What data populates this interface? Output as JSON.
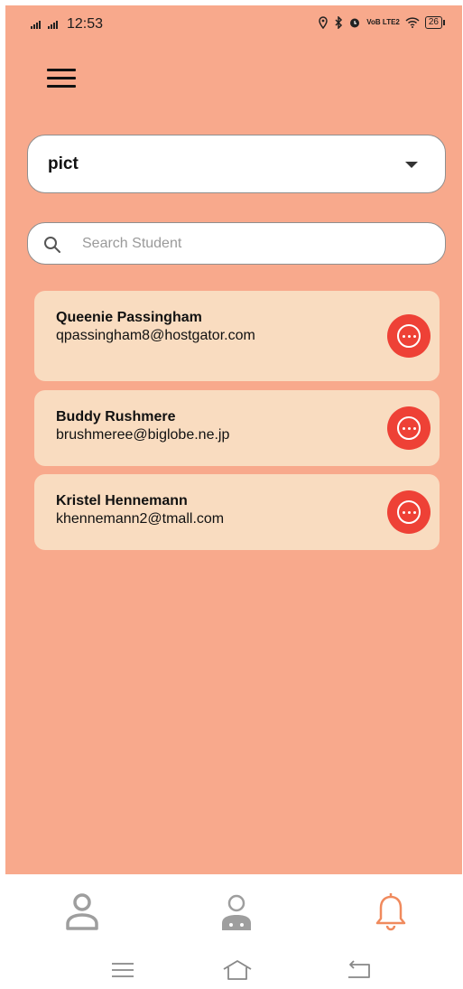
{
  "status_bar": {
    "time": "12:53",
    "network_badge": "VoB LTE2",
    "battery": "26"
  },
  "college_dropdown": {
    "selected": "pict"
  },
  "search": {
    "placeholder": "Search Student",
    "value": ""
  },
  "students": [
    {
      "name": "Queenie Passingham",
      "email": "qpassingham8@hostgator.com"
    },
    {
      "name": "Buddy Rushmere",
      "email": "brushmeree@biglobe.ne.jp"
    },
    {
      "name": "Kristel Hennemann",
      "email": "khennemann2@tmall.com"
    }
  ],
  "bottom_nav": {
    "items": [
      {
        "icon": "person-icon",
        "active": false
      },
      {
        "icon": "doctor-icon",
        "active": false
      },
      {
        "icon": "bell-icon",
        "active": true
      }
    ]
  },
  "colors": {
    "background": "#f8a98c",
    "card": "#f9dcc0",
    "accent": "#ee4136",
    "active_nav": "#f08a5d",
    "inactive_nav": "#9e9e9e"
  }
}
